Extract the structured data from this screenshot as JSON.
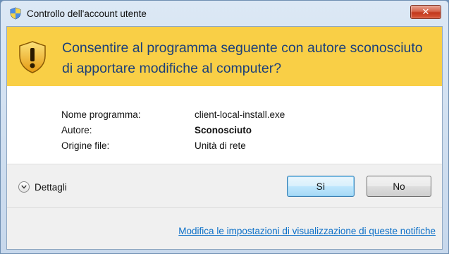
{
  "window": {
    "title": "Controllo dell'account utente",
    "close_label": "✕"
  },
  "banner": {
    "message": "Consentire al programma seguente con autore sconosciuto di apportare modifiche al computer?"
  },
  "info": {
    "rows": [
      {
        "label": "Nome programma:",
        "value": "client-local-install.exe"
      },
      {
        "label": "Autore:",
        "value": "Sconosciuto"
      },
      {
        "label": "Origine file:",
        "value": "Unità di rete"
      }
    ]
  },
  "footer": {
    "details_label": "Dettagli",
    "yes_label": "Sì",
    "no_label": "No",
    "settings_link": "Modifica le impostazioni di visualizzazione di queste notifiche"
  },
  "colors": {
    "banner": "#f9cf46",
    "banner_text": "#1b3f7a",
    "link": "#0b6fc7",
    "close_button": "#c2381c"
  },
  "icons": {
    "title": "uac-shield-icon",
    "banner": "warning-shield-icon",
    "details": "chevron-down-icon",
    "close": "close-icon"
  }
}
